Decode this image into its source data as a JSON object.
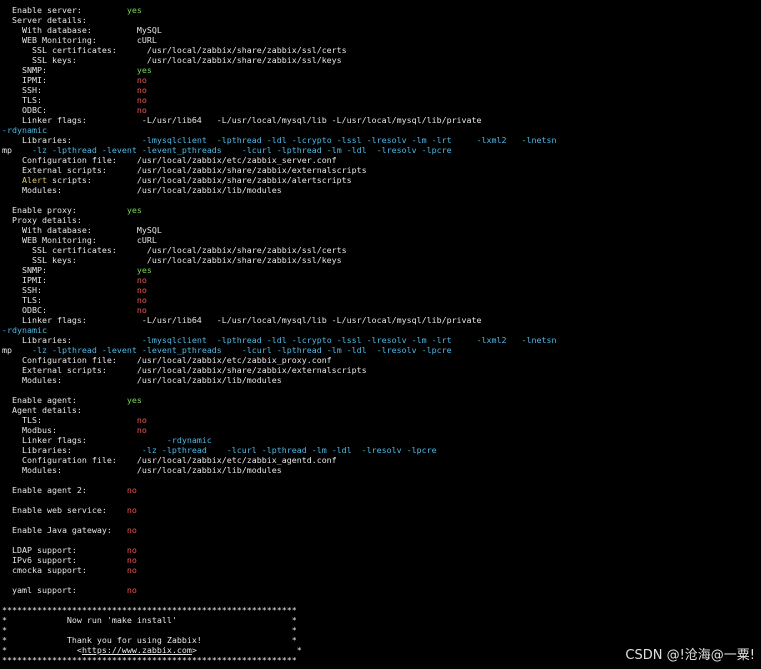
{
  "terminal": {
    "lines": [
      [
        {
          "t": "  Enable server:         ",
          "c": "w"
        },
        {
          "t": "yes",
          "c": "g"
        }
      ],
      [
        {
          "t": "  Server details:",
          "c": "w"
        }
      ],
      [
        {
          "t": "    With database:         MySQL",
          "c": "w"
        }
      ],
      [
        {
          "t": "    WEB Monitoring:        cURL",
          "c": "w"
        }
      ],
      [
        {
          "t": "      SSL certificates:      /usr/local/zabbix/share/zabbix/ssl/certs",
          "c": "w"
        }
      ],
      [
        {
          "t": "      SSL keys:              /usr/local/zabbix/share/zabbix/ssl/keys",
          "c": "w"
        }
      ],
      [
        {
          "t": "    SNMP:                  ",
          "c": "w"
        },
        {
          "t": "yes",
          "c": "g"
        }
      ],
      [
        {
          "t": "    IPMI:                  ",
          "c": "w"
        },
        {
          "t": "no",
          "c": "r"
        }
      ],
      [
        {
          "t": "    SSH:                   ",
          "c": "w"
        },
        {
          "t": "no",
          "c": "r"
        }
      ],
      [
        {
          "t": "    TLS:                   ",
          "c": "w"
        },
        {
          "t": "no",
          "c": "r"
        }
      ],
      [
        {
          "t": "    ODBC:                  ",
          "c": "w"
        },
        {
          "t": "no",
          "c": "r"
        }
      ],
      [
        {
          "t": "    Linker flags:           -L/usr/lib64   -L/usr/local/mysql/lib -L/usr/local/mysql/lib/private",
          "c": "w"
        }
      ],
      [
        {
          "t": "-rdynamic",
          "c": "b"
        }
      ],
      [
        {
          "t": "    Libraries:              ",
          "c": "w"
        },
        {
          "t": "-lmysqlclient  -lpthread -ldl -lcrypto -lssl -lresolv -lm -lrt     -lxml2   -lnetsn",
          "c": "b"
        }
      ],
      [
        {
          "t": "mp    ",
          "c": "w"
        },
        {
          "t": "-lz -lpthread -levent -levent_pthreads    -lcurl -lpthread -lm -ldl  -lresolv -lpcre",
          "c": "b"
        }
      ],
      [
        {
          "t": "    Configuration file:    /usr/local/zabbix/etc/zabbix_server.conf",
          "c": "w"
        }
      ],
      [
        {
          "t": "    External scripts:      /usr/local/zabbix/share/zabbix/externalscripts",
          "c": "w"
        }
      ],
      [
        {
          "t": "    ",
          "c": "w"
        },
        {
          "t": "Alert",
          "c": "y"
        },
        {
          "t": " scripts:         /usr/local/zabbix/share/zabbix/alertscripts",
          "c": "w"
        }
      ],
      [
        {
          "t": "    Modules:               /usr/local/zabbix/lib/modules",
          "c": "w"
        }
      ],
      [
        {
          "t": "",
          "c": "w"
        }
      ],
      [
        {
          "t": "  Enable proxy:          ",
          "c": "w"
        },
        {
          "t": "yes",
          "c": "g"
        }
      ],
      [
        {
          "t": "  Proxy details:",
          "c": "w"
        }
      ],
      [
        {
          "t": "    With database:         MySQL",
          "c": "w"
        }
      ],
      [
        {
          "t": "    WEB Monitoring:        cURL",
          "c": "w"
        }
      ],
      [
        {
          "t": "      SSL certificates:      /usr/local/zabbix/share/zabbix/ssl/certs",
          "c": "w"
        }
      ],
      [
        {
          "t": "      SSL keys:              /usr/local/zabbix/share/zabbix/ssl/keys",
          "c": "w"
        }
      ],
      [
        {
          "t": "    SNMP:                  ",
          "c": "w"
        },
        {
          "t": "yes",
          "c": "g"
        }
      ],
      [
        {
          "t": "    IPMI:                  ",
          "c": "w"
        },
        {
          "t": "no",
          "c": "r"
        }
      ],
      [
        {
          "t": "    SSH:                   ",
          "c": "w"
        },
        {
          "t": "no",
          "c": "r"
        }
      ],
      [
        {
          "t": "    TLS:                   ",
          "c": "w"
        },
        {
          "t": "no",
          "c": "r"
        }
      ],
      [
        {
          "t": "    ODBC:                  ",
          "c": "w"
        },
        {
          "t": "no",
          "c": "r"
        }
      ],
      [
        {
          "t": "    Linker flags:           -L/usr/lib64   -L/usr/local/mysql/lib -L/usr/local/mysql/lib/private",
          "c": "w"
        }
      ],
      [
        {
          "t": "-rdynamic",
          "c": "b"
        }
      ],
      [
        {
          "t": "    Libraries:              ",
          "c": "w"
        },
        {
          "t": "-lmysqlclient  -lpthread -ldl -lcrypto -lssl -lresolv -lm -lrt     -lxml2   -lnetsn",
          "c": "b"
        }
      ],
      [
        {
          "t": "mp    ",
          "c": "w"
        },
        {
          "t": "-lz -lpthread -levent -levent_pthreads    -lcurl -lpthread -lm -ldl  -lresolv -lpcre",
          "c": "b"
        }
      ],
      [
        {
          "t": "    Configuration file:    /usr/local/zabbix/etc/zabbix_proxy.conf",
          "c": "w"
        }
      ],
      [
        {
          "t": "    External scripts:      /usr/local/zabbix/share/zabbix/externalscripts",
          "c": "w"
        }
      ],
      [
        {
          "t": "    Modules:               /usr/local/zabbix/lib/modules",
          "c": "w"
        }
      ],
      [
        {
          "t": "",
          "c": "w"
        }
      ],
      [
        {
          "t": "  Enable agent:          ",
          "c": "w"
        },
        {
          "t": "yes",
          "c": "g"
        }
      ],
      [
        {
          "t": "  Agent details:",
          "c": "w"
        }
      ],
      [
        {
          "t": "    TLS:                   ",
          "c": "w"
        },
        {
          "t": "no",
          "c": "r"
        }
      ],
      [
        {
          "t": "    Modbus:                ",
          "c": "w"
        },
        {
          "t": "no",
          "c": "r"
        }
      ],
      [
        {
          "t": "    Linker flags:                ",
          "c": "w"
        },
        {
          "t": "-rdynamic",
          "c": "b"
        }
      ],
      [
        {
          "t": "    Libraries:              ",
          "c": "w"
        },
        {
          "t": "-lz -lpthread    -lcurl -lpthread -lm -ldl  -lresolv -lpcre",
          "c": "b"
        }
      ],
      [
        {
          "t": "    Configuration file:    /usr/local/zabbix/etc/zabbix_agentd.conf",
          "c": "w"
        }
      ],
      [
        {
          "t": "    Modules:               /usr/local/zabbix/lib/modules",
          "c": "w"
        }
      ],
      [
        {
          "t": "",
          "c": "w"
        }
      ],
      [
        {
          "t": "  Enable agent 2:        ",
          "c": "w"
        },
        {
          "t": "no",
          "c": "r"
        }
      ],
      [
        {
          "t": "",
          "c": "w"
        }
      ],
      [
        {
          "t": "  Enable web service:    ",
          "c": "w"
        },
        {
          "t": "no",
          "c": "r"
        }
      ],
      [
        {
          "t": "",
          "c": "w"
        }
      ],
      [
        {
          "t": "  Enable Java gateway:   ",
          "c": "w"
        },
        {
          "t": "no",
          "c": "r"
        }
      ],
      [
        {
          "t": "",
          "c": "w"
        }
      ],
      [
        {
          "t": "  LDAP support:          ",
          "c": "w"
        },
        {
          "t": "no",
          "c": "r"
        }
      ],
      [
        {
          "t": "  IPv6 support:          ",
          "c": "w"
        },
        {
          "t": "no",
          "c": "r"
        }
      ],
      [
        {
          "t": "  cmocka support:        ",
          "c": "w"
        },
        {
          "t": "no",
          "c": "r"
        }
      ],
      [
        {
          "t": "",
          "c": "w"
        }
      ],
      [
        {
          "t": "  yaml support:          ",
          "c": "w"
        },
        {
          "t": "no",
          "c": "r"
        }
      ],
      [
        {
          "t": "",
          "c": "w"
        }
      ],
      [
        {
          "t": "***********************************************************",
          "c": "w"
        }
      ],
      [
        {
          "t": "*            Now run 'make install'                       *",
          "c": "w"
        }
      ],
      [
        {
          "t": "*                                                         *",
          "c": "w"
        }
      ],
      [
        {
          "t": "*            Thank you for using Zabbix!                  *",
          "c": "w"
        }
      ],
      [
        {
          "t": "*              <",
          "c": "w"
        },
        {
          "t": "https://www.zabbix.com",
          "c": "w lnk"
        },
        {
          "t": ">                    *",
          "c": "w"
        }
      ],
      [
        {
          "t": "***********************************************************",
          "c": "w"
        }
      ]
    ]
  },
  "watermark": "CSDN @!沧海@一粟!",
  "colors": {
    "background": "#000000",
    "text": "#e6e6e6",
    "yes": "#7dd35c",
    "no": "#ef5656",
    "flags": "#4fb8e6",
    "highlight": "#d6c56a"
  }
}
